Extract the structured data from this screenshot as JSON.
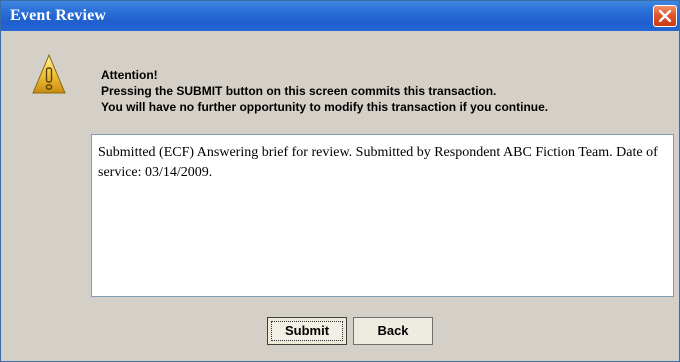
{
  "window": {
    "title": "Event Review",
    "close_icon": "close-icon"
  },
  "dialog": {
    "icon": "warning-icon",
    "message_lines": [
      "Attention!",
      "Pressing the SUBMIT button on this screen commits this transaction.",
      "You will have no further opportunity to modify this transaction if you continue."
    ],
    "details_text": "Submitted (ECF) Answering brief for review. Submitted by Respondent ABC Fiction Team. Date of service: 03/14/2009."
  },
  "buttons": {
    "submit_label": "Submit",
    "back_label": "Back"
  },
  "colors": {
    "titlebar": "#2a6fd6",
    "close_button": "#e2552b",
    "warning_icon": "#f3c33a",
    "background": "#d4d0c8"
  }
}
